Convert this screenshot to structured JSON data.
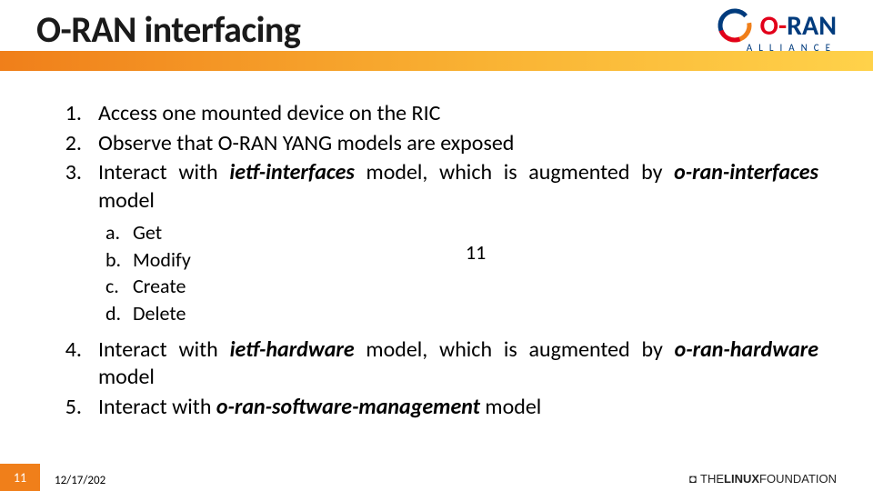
{
  "header": {
    "title": "O-RAN interfacing",
    "logo": {
      "o": "O",
      "dash": "-",
      "ran": "RAN",
      "alliance": "ALLIANCE"
    }
  },
  "list": {
    "n1": "1.",
    "t1": "Access one mounted device on the RIC",
    "n2": "2.",
    "t2": "Observe that O-RAN YANG models are exposed",
    "n3": "3.",
    "t3a": "Interact with ",
    "t3b": "ietf-interfaces",
    "t3c": " model, which is augmented by ",
    "t3d": "o-ran-interfaces",
    "t3e": " model",
    "sa": "a.",
    "va": "Get",
    "sb": "b.",
    "vb": "Modify",
    "sc": "c.",
    "vc": "Create",
    "sd": "d.",
    "vd": "Delete",
    "n4": "4.",
    "t4a": "Interact with ",
    "t4b": "ietf-hardware",
    "t4c": " model, which is augmented by ",
    "t4d": "o-ran-hardware",
    "t4e": " model",
    "n5": "5.",
    "t5a": "Interact with ",
    "t5b": "o-ran-software-management",
    "t5c": " model"
  },
  "mid_number": "11",
  "footer": {
    "page": "11",
    "date": "12/17/202",
    "lf_the": "THE",
    "lf_linux": "LINUX",
    "lf_found": "FOUNDATION"
  }
}
